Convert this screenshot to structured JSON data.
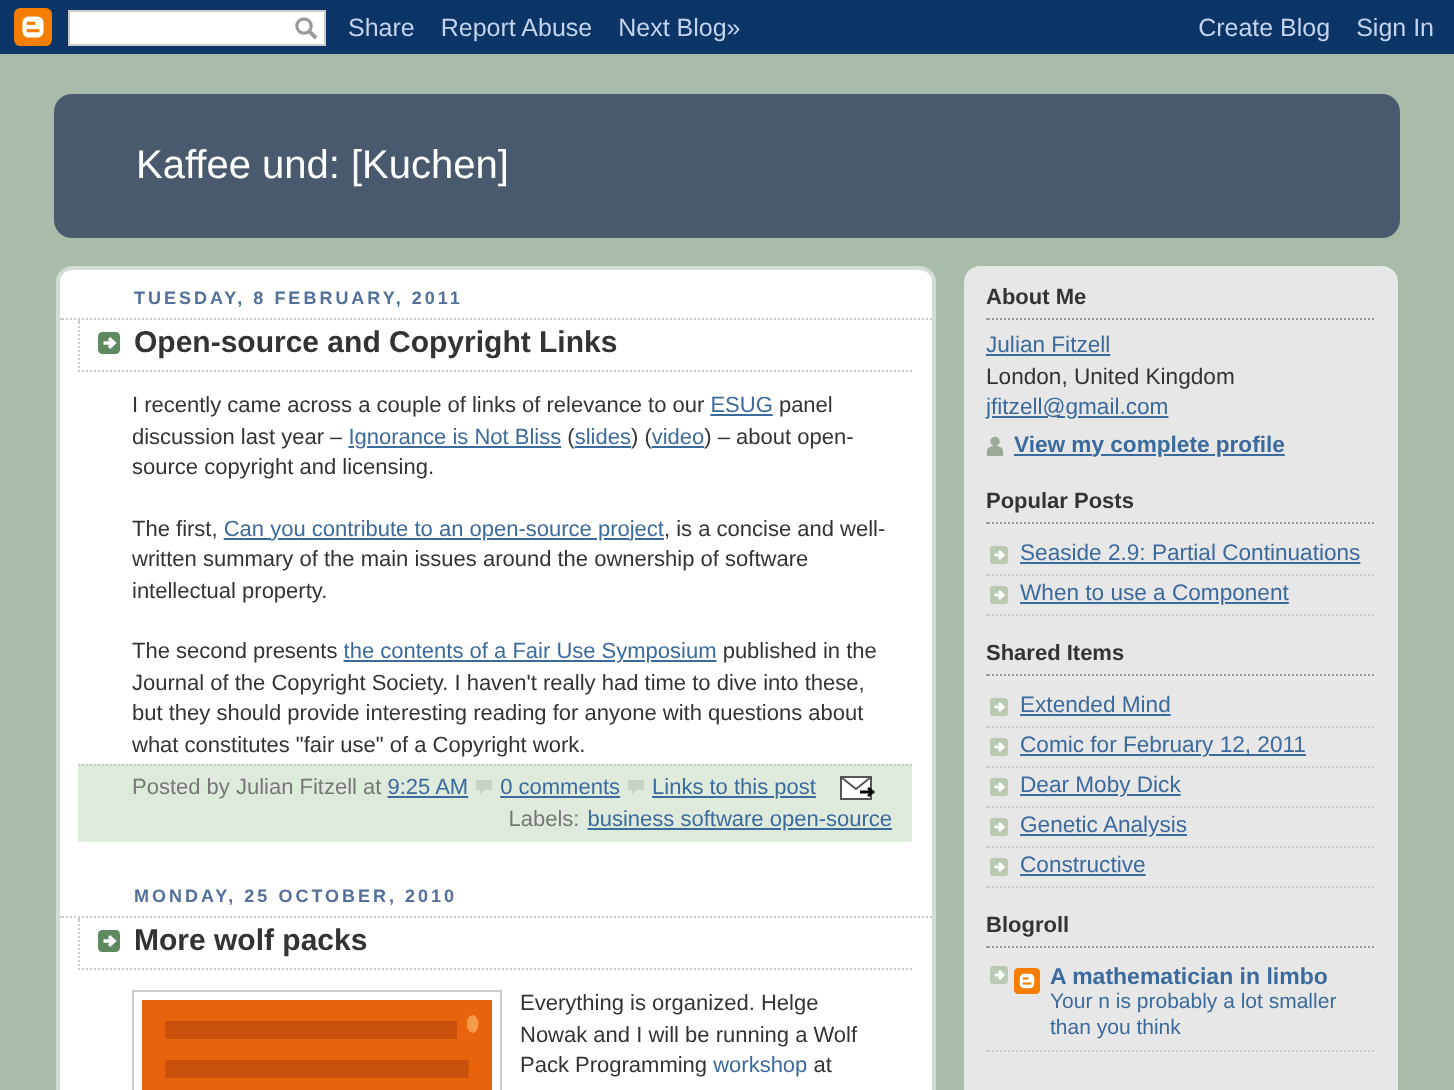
{
  "topbar": {
    "links": [
      "Share",
      "Report Abuse",
      "Next Blog»"
    ],
    "right_links": [
      "Create Blog",
      "Sign In"
    ]
  },
  "header": {
    "title": "Kaffee und: [Kuchen]"
  },
  "posts": [
    {
      "date": "TUESDAY, 8 FEBRUARY, 2011",
      "title": "Open-source and Copyright Links",
      "paragraphs": [
        [
          {
            "text": "I recently came across a couple of links of relevance to our "
          },
          {
            "link": "ESUG"
          },
          {
            "text": " panel discussion last year – "
          },
          {
            "link": "Ignorance is Not Bliss"
          },
          {
            "text": " ("
          },
          {
            "link": "slides"
          },
          {
            "text": ") ("
          },
          {
            "link": "video"
          },
          {
            "text": ") – about open-source copyright and licensing."
          }
        ],
        [
          {
            "text": "The first, "
          },
          {
            "link": "Can you contribute to an open-source project"
          },
          {
            "text": ", is a concise and well-written summary of the main issues around the ownership of software intellectual property."
          }
        ],
        [
          {
            "text": "The second presents "
          },
          {
            "link": "the contents of a Fair Use Symposium"
          },
          {
            "text": " published in the Journal of the Copyright Society. I haven't really had time to dive into these, but they should provide interesting reading for anyone with questions about what constitutes \"fair use\" of a Copyright work."
          }
        ]
      ],
      "footer": {
        "posted_by": "Posted by Julian Fitzell",
        "at": "at",
        "time": "9:25 AM",
        "comments": "0 comments",
        "backlinks": "Links to this post",
        "labels_label": "Labels:",
        "labels": "business software open-source"
      }
    },
    {
      "date": "MONDAY, 25 OCTOBER, 2010",
      "title": "More wolf packs",
      "image": {
        "kind": "picture"
      },
      "paragraphs": [
        [
          {
            "text": "Everything is organized. Helge Nowak and I will be running a Wolf Pack Programming "
          },
          {
            "link": "workshop",
            "plain": true
          },
          {
            "text": " at"
          }
        ]
      ]
    }
  ],
  "sidebar": [
    {
      "kind": "profile",
      "title": "About Me",
      "name": "Julian Fitzell",
      "location": "London, United Kingdom",
      "email": "jfitzell@gmail.com",
      "profile_link": "View my complete profile"
    },
    {
      "kind": "list",
      "title": "Popular Posts",
      "items": [
        "Seaside 2.9: Partial Continuations",
        "When to use a Component"
      ]
    },
    {
      "kind": "list",
      "title": "Shared Items",
      "items": [
        "Extended Mind",
        "Comic for February 12, 2011",
        "Dear Moby Dick",
        "Genetic Analysis",
        "Constructive"
      ]
    },
    {
      "kind": "blogroll",
      "title": "Blogroll",
      "items": [
        {
          "title": "A mathematician in limbo",
          "snippet": "Your n is probably a lot smaller than you think"
        }
      ]
    }
  ]
}
